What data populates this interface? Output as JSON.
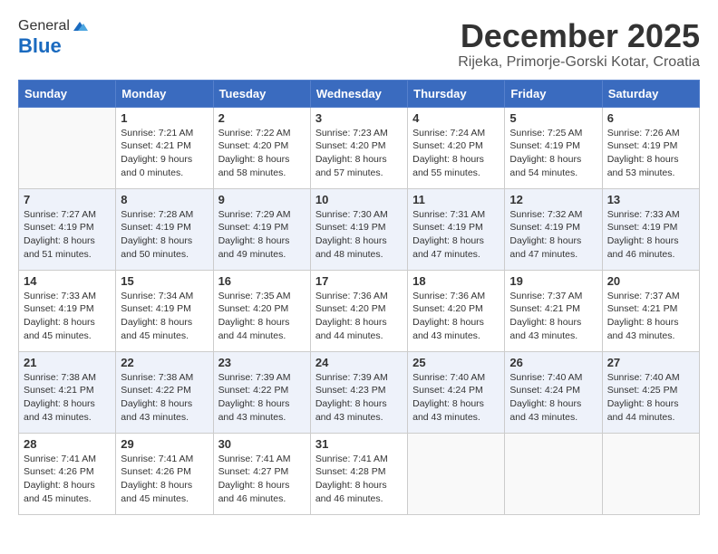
{
  "header": {
    "logo_general": "General",
    "logo_blue": "Blue",
    "month_title": "December 2025",
    "location": "Rijeka, Primorje-Gorski Kotar, Croatia"
  },
  "days_of_week": [
    "Sunday",
    "Monday",
    "Tuesday",
    "Wednesday",
    "Thursday",
    "Friday",
    "Saturday"
  ],
  "weeks": [
    [
      {
        "day": "",
        "sunrise": "",
        "sunset": "",
        "daylight": ""
      },
      {
        "day": "1",
        "sunrise": "Sunrise: 7:21 AM",
        "sunset": "Sunset: 4:21 PM",
        "daylight": "Daylight: 9 hours and 0 minutes."
      },
      {
        "day": "2",
        "sunrise": "Sunrise: 7:22 AM",
        "sunset": "Sunset: 4:20 PM",
        "daylight": "Daylight: 8 hours and 58 minutes."
      },
      {
        "day": "3",
        "sunrise": "Sunrise: 7:23 AM",
        "sunset": "Sunset: 4:20 PM",
        "daylight": "Daylight: 8 hours and 57 minutes."
      },
      {
        "day": "4",
        "sunrise": "Sunrise: 7:24 AM",
        "sunset": "Sunset: 4:20 PM",
        "daylight": "Daylight: 8 hours and 55 minutes."
      },
      {
        "day": "5",
        "sunrise": "Sunrise: 7:25 AM",
        "sunset": "Sunset: 4:19 PM",
        "daylight": "Daylight: 8 hours and 54 minutes."
      },
      {
        "day": "6",
        "sunrise": "Sunrise: 7:26 AM",
        "sunset": "Sunset: 4:19 PM",
        "daylight": "Daylight: 8 hours and 53 minutes."
      }
    ],
    [
      {
        "day": "7",
        "sunrise": "Sunrise: 7:27 AM",
        "sunset": "Sunset: 4:19 PM",
        "daylight": "Daylight: 8 hours and 51 minutes."
      },
      {
        "day": "8",
        "sunrise": "Sunrise: 7:28 AM",
        "sunset": "Sunset: 4:19 PM",
        "daylight": "Daylight: 8 hours and 50 minutes."
      },
      {
        "day": "9",
        "sunrise": "Sunrise: 7:29 AM",
        "sunset": "Sunset: 4:19 PM",
        "daylight": "Daylight: 8 hours and 49 minutes."
      },
      {
        "day": "10",
        "sunrise": "Sunrise: 7:30 AM",
        "sunset": "Sunset: 4:19 PM",
        "daylight": "Daylight: 8 hours and 48 minutes."
      },
      {
        "day": "11",
        "sunrise": "Sunrise: 7:31 AM",
        "sunset": "Sunset: 4:19 PM",
        "daylight": "Daylight: 8 hours and 47 minutes."
      },
      {
        "day": "12",
        "sunrise": "Sunrise: 7:32 AM",
        "sunset": "Sunset: 4:19 PM",
        "daylight": "Daylight: 8 hours and 47 minutes."
      },
      {
        "day": "13",
        "sunrise": "Sunrise: 7:33 AM",
        "sunset": "Sunset: 4:19 PM",
        "daylight": "Daylight: 8 hours and 46 minutes."
      }
    ],
    [
      {
        "day": "14",
        "sunrise": "Sunrise: 7:33 AM",
        "sunset": "Sunset: 4:19 PM",
        "daylight": "Daylight: 8 hours and 45 minutes."
      },
      {
        "day": "15",
        "sunrise": "Sunrise: 7:34 AM",
        "sunset": "Sunset: 4:19 PM",
        "daylight": "Daylight: 8 hours and 45 minutes."
      },
      {
        "day": "16",
        "sunrise": "Sunrise: 7:35 AM",
        "sunset": "Sunset: 4:20 PM",
        "daylight": "Daylight: 8 hours and 44 minutes."
      },
      {
        "day": "17",
        "sunrise": "Sunrise: 7:36 AM",
        "sunset": "Sunset: 4:20 PM",
        "daylight": "Daylight: 8 hours and 44 minutes."
      },
      {
        "day": "18",
        "sunrise": "Sunrise: 7:36 AM",
        "sunset": "Sunset: 4:20 PM",
        "daylight": "Daylight: 8 hours and 43 minutes."
      },
      {
        "day": "19",
        "sunrise": "Sunrise: 7:37 AM",
        "sunset": "Sunset: 4:21 PM",
        "daylight": "Daylight: 8 hours and 43 minutes."
      },
      {
        "day": "20",
        "sunrise": "Sunrise: 7:37 AM",
        "sunset": "Sunset: 4:21 PM",
        "daylight": "Daylight: 8 hours and 43 minutes."
      }
    ],
    [
      {
        "day": "21",
        "sunrise": "Sunrise: 7:38 AM",
        "sunset": "Sunset: 4:21 PM",
        "daylight": "Daylight: 8 hours and 43 minutes."
      },
      {
        "day": "22",
        "sunrise": "Sunrise: 7:38 AM",
        "sunset": "Sunset: 4:22 PM",
        "daylight": "Daylight: 8 hours and 43 minutes."
      },
      {
        "day": "23",
        "sunrise": "Sunrise: 7:39 AM",
        "sunset": "Sunset: 4:22 PM",
        "daylight": "Daylight: 8 hours and 43 minutes."
      },
      {
        "day": "24",
        "sunrise": "Sunrise: 7:39 AM",
        "sunset": "Sunset: 4:23 PM",
        "daylight": "Daylight: 8 hours and 43 minutes."
      },
      {
        "day": "25",
        "sunrise": "Sunrise: 7:40 AM",
        "sunset": "Sunset: 4:24 PM",
        "daylight": "Daylight: 8 hours and 43 minutes."
      },
      {
        "day": "26",
        "sunrise": "Sunrise: 7:40 AM",
        "sunset": "Sunset: 4:24 PM",
        "daylight": "Daylight: 8 hours and 43 minutes."
      },
      {
        "day": "27",
        "sunrise": "Sunrise: 7:40 AM",
        "sunset": "Sunset: 4:25 PM",
        "daylight": "Daylight: 8 hours and 44 minutes."
      }
    ],
    [
      {
        "day": "28",
        "sunrise": "Sunrise: 7:41 AM",
        "sunset": "Sunset: 4:26 PM",
        "daylight": "Daylight: 8 hours and 45 minutes."
      },
      {
        "day": "29",
        "sunrise": "Sunrise: 7:41 AM",
        "sunset": "Sunset: 4:26 PM",
        "daylight": "Daylight: 8 hours and 45 minutes."
      },
      {
        "day": "30",
        "sunrise": "Sunrise: 7:41 AM",
        "sunset": "Sunset: 4:27 PM",
        "daylight": "Daylight: 8 hours and 46 minutes."
      },
      {
        "day": "31",
        "sunrise": "Sunrise: 7:41 AM",
        "sunset": "Sunset: 4:28 PM",
        "daylight": "Daylight: 8 hours and 46 minutes."
      },
      {
        "day": "",
        "sunrise": "",
        "sunset": "",
        "daylight": ""
      },
      {
        "day": "",
        "sunrise": "",
        "sunset": "",
        "daylight": ""
      },
      {
        "day": "",
        "sunrise": "",
        "sunset": "",
        "daylight": ""
      }
    ]
  ]
}
